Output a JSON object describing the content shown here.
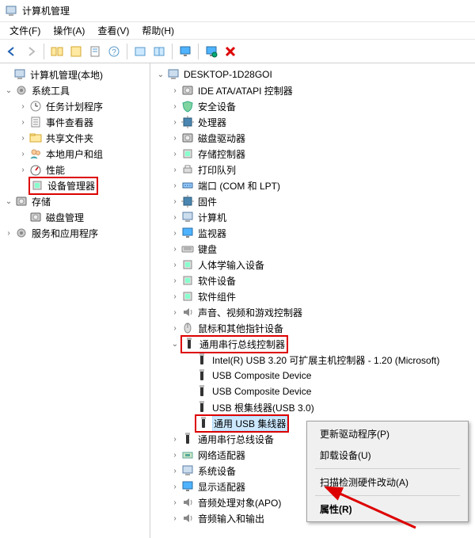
{
  "window_title": "计算机管理",
  "menubar": {
    "file": "文件(F)",
    "action": "操作(A)",
    "view": "查看(V)",
    "help": "帮助(H)"
  },
  "left_root": "计算机管理(本地)",
  "left_systools": "系统工具",
  "left_systools_items": {
    "scheduler": "任务计划程序",
    "eventviewer": "事件查看器",
    "sharedfolders": "共享文件夹",
    "localusers": "本地用户和组",
    "performance": "性能",
    "devicemgr": "设备管理器"
  },
  "left_storage": "存储",
  "left_storage_items": {
    "diskmgmt": "磁盘管理"
  },
  "left_services": "服务和应用程序",
  "right_root": "DESKTOP-1D28GOI",
  "right_categories": {
    "ide": "IDE ATA/ATAPI 控制器",
    "security": "安全设备",
    "cpu": "处理器",
    "diskdrive": "磁盘驱动器",
    "storagectrl": "存储控制器",
    "printq": "打印队列",
    "ports": "端口 (COM 和 LPT)",
    "firmware": "固件",
    "computer": "计算机",
    "monitor": "监视器",
    "keyboard": "键盘",
    "hid": "人体学输入设备",
    "swdev": "软件设备",
    "swcomp": "软件组件",
    "audio": "声音、视频和游戏控制器",
    "mouse": "鼠标和其他指针设备",
    "usb": "通用串行总线控制器",
    "usbdev": "通用串行总线设备",
    "network": "网络适配器",
    "system": "系统设备",
    "display": "显示适配器",
    "apo": "音频处理对象(APO)",
    "audioin": "音频输入和输出"
  },
  "usb_children": {
    "intel": "Intel(R) USB 3.20 可扩展主机控制器 - 1.20 (Microsoft)",
    "comp1": "USB Composite Device",
    "comp2": "USB Composite Device",
    "roothub": "USB 根集线器(USB 3.0)",
    "hub": "通用 USB 集线器"
  },
  "context_menu": {
    "update": "更新驱动程序(P)",
    "uninstall": "卸载设备(U)",
    "scan": "扫描检测硬件改动(A)",
    "properties": "属性(R)"
  }
}
